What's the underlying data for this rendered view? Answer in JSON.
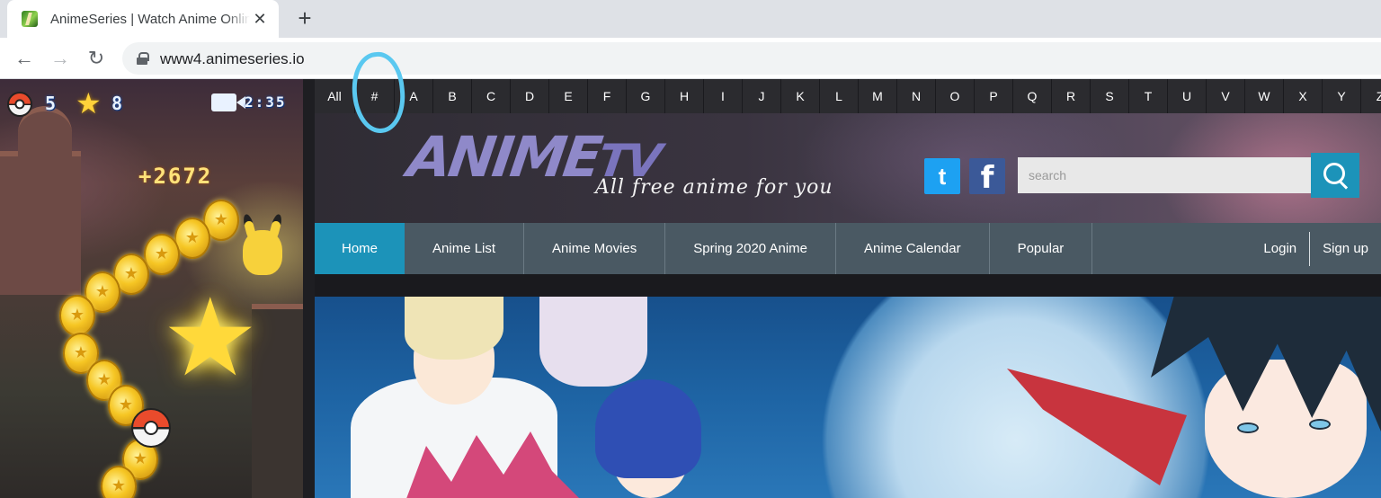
{
  "browser": {
    "tab_title": "AnimeSeries | Watch Anime Online",
    "tab_close": "✕",
    "new_tab": "+",
    "back": "←",
    "forward": "→",
    "reload": "↻",
    "url": "www4.animeseries.io"
  },
  "ad": {
    "pokeballs": "5",
    "stars": "8",
    "timer": "2:35",
    "score": "+2672"
  },
  "az_bar": {
    "items": [
      "All",
      "#",
      "A",
      "B",
      "C",
      "D",
      "E",
      "F",
      "G",
      "H",
      "I",
      "J",
      "K",
      "L",
      "M",
      "N",
      "O",
      "P",
      "Q",
      "R",
      "S",
      "T",
      "U",
      "V",
      "W",
      "X",
      "Y",
      "Z"
    ]
  },
  "header": {
    "logo_main": "ANIME",
    "logo_tv": "TV",
    "tagline": "All free anime for you",
    "twitter_glyph": "t",
    "facebook_glyph": "f",
    "search_placeholder": "search"
  },
  "nav": {
    "items": [
      "Home",
      "Anime List",
      "Anime Movies",
      "Spring 2020 Anime",
      "Anime Calendar",
      "Popular"
    ],
    "active": "Home",
    "login": "Login",
    "signup": "Sign up"
  },
  "colors": {
    "accent": "#1c93b9",
    "nav_bg": "#4a5963",
    "az_bg": "#2b2b2f",
    "annotation": "#5ac8f0"
  }
}
